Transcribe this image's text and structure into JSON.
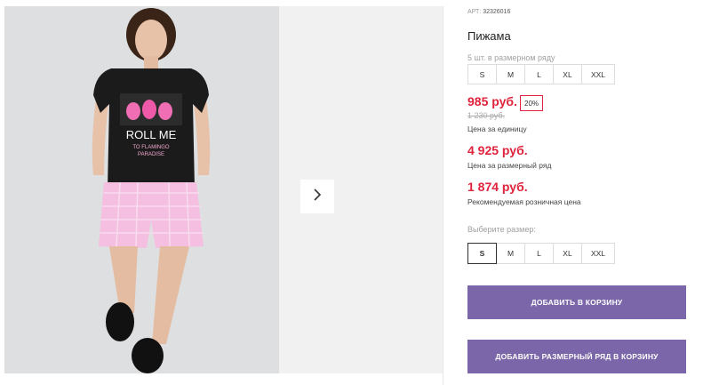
{
  "gallery": {
    "shirt_print_line1": "ROLL ME",
    "shirt_print_line2": "TO FLAMINGO",
    "shirt_print_line3": "PARADISE"
  },
  "product": {
    "article_label": "АРТ:",
    "article": "32326016",
    "title": "Пижама",
    "pack_note": "5 шт. в размерном ряду",
    "pack_sizes": [
      "S",
      "M",
      "L",
      "XL",
      "XXL"
    ],
    "price": "985 руб.",
    "discount": "20%",
    "old_price": "1 230 руб.",
    "unit_label": "Цена за единицу",
    "pack_price": "4 925 руб.",
    "pack_label": "Цена за размерный ряд",
    "rrp": "1 874 руб.",
    "rrp_label": "Рекомендуемая розничная цена",
    "choose_label": "Выберите размер:",
    "choose_sizes": [
      "S",
      "M",
      "L",
      "XL",
      "XXL"
    ],
    "selected_size": "S",
    "add_to_cart": "ДОБАВИТЬ В КОРЗИНУ",
    "add_pack_to_cart": "ДОБАВИТЬ РАЗМЕРНЫЙ РЯД В КОРЗИНУ"
  },
  "colors": {
    "accent": "#7a66a8",
    "price": "#e0233c"
  }
}
